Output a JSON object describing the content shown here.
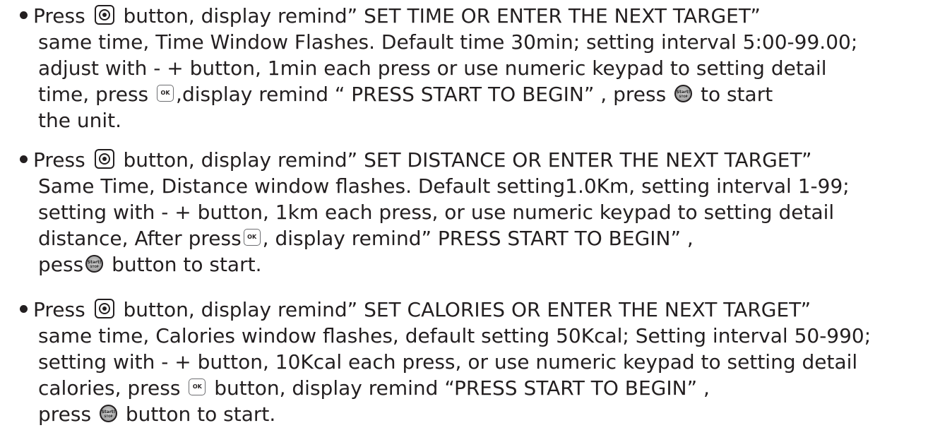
{
  "items": [
    {
      "lines": [
        [
          "Press ",
          "icon:target",
          " button, display remind” SET TIME OR ENTER THE NEXT TARGET”"
        ],
        [
          "same time, Time Window Flashes. Default time 30min; setting interval 5:00-99.00;"
        ],
        [
          "adjust with - + button, 1min each press or use numeric keypad to setting detail"
        ],
        [
          "time, press ",
          "icon:ok",
          ",display remind “ PRESS START TO BEGIN” , press ",
          "icon:start",
          " to start"
        ],
        [
          "the unit."
        ]
      ]
    },
    {
      "lines": [
        [
          "Press ",
          "icon:target",
          " button, display remind” SET DISTANCE OR ENTER THE NEXT TARGET”"
        ],
        [
          "Same Time, Distance window flashes. Default setting1.0Km, setting interval 1-99;"
        ],
        [
          "setting with - + button, 1km each press, or use numeric keypad to setting detail"
        ],
        [
          "distance, After press",
          "icon:ok",
          ", display remind” PRESS START TO BEGIN” ,"
        ],
        [
          "pess",
          "icon:start",
          " button to start."
        ]
      ]
    },
    {
      "lines": [
        [
          "Press ",
          "icon:target",
          " button, display remind” SET CALORIES OR ENTER THE NEXT TARGET”"
        ],
        [
          "same time, Calories window flashes, default setting 50Kcal; Setting interval 50-990;"
        ],
        [
          " setting with - + button, 10Kcal each press, or use numeric keypad to setting detail"
        ],
        [
          "calories, press ",
          "icon:ok",
          " button, display remind “PRESS START TO BEGIN” ,"
        ],
        [
          "press ",
          "icon:start",
          " button to start."
        ]
      ]
    }
  ],
  "icons": {
    "ok_label": "OK",
    "start_label": "Start!",
    "start_sub": "STOP"
  }
}
